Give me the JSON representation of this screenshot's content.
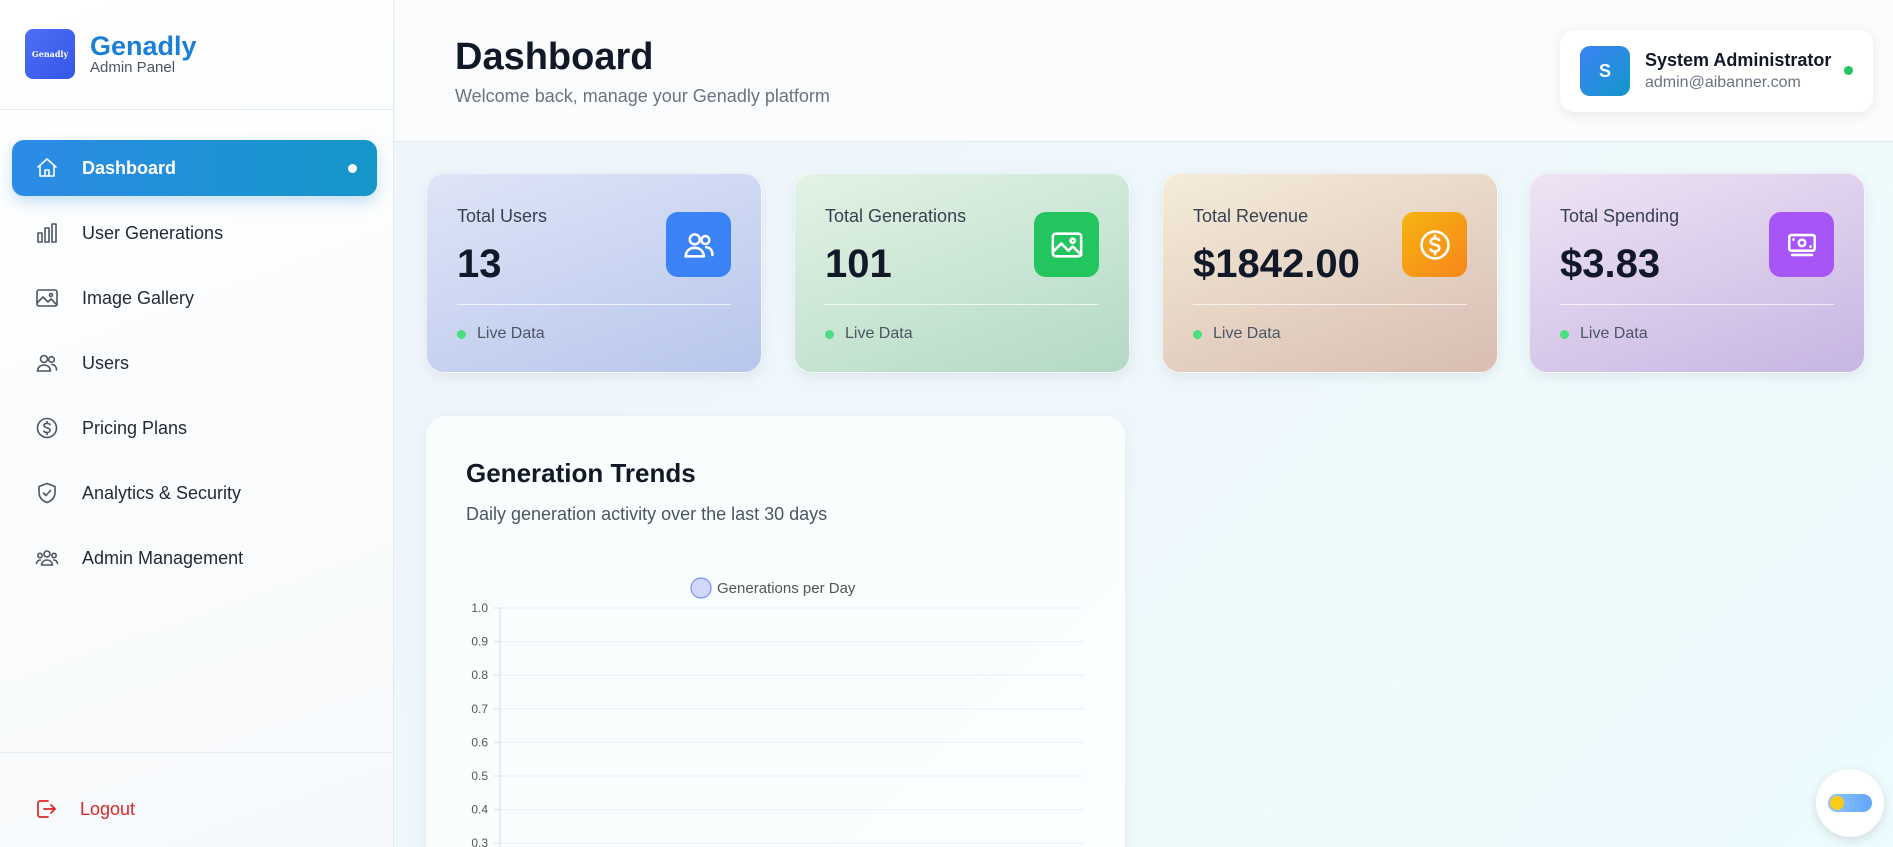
{
  "brand": {
    "logo_text": "Genadly",
    "name": "Genadly",
    "subtitle": "Admin Panel"
  },
  "sidebar": {
    "items": [
      {
        "label": "Dashboard",
        "icon": "home-icon",
        "active": true
      },
      {
        "label": "User Generations",
        "icon": "bar-chart-icon"
      },
      {
        "label": "Image Gallery",
        "icon": "image-icon"
      },
      {
        "label": "Users",
        "icon": "users-icon"
      },
      {
        "label": "Pricing Plans",
        "icon": "dollar-circle-icon"
      },
      {
        "label": "Analytics & Security",
        "icon": "shield-check-icon"
      },
      {
        "label": "Admin Management",
        "icon": "team-icon"
      }
    ],
    "logout_label": "Logout"
  },
  "header": {
    "title": "Dashboard",
    "subtitle": "Welcome back, manage your Genadly platform",
    "user": {
      "initial": "S",
      "name": "System Administrator",
      "email": "admin@aibanner.com",
      "status": "online"
    }
  },
  "stats": [
    {
      "label": "Total Users",
      "value": "13",
      "status": "Live Data",
      "icon": "users-icon",
      "color": "#3b82f6"
    },
    {
      "label": "Total Generations",
      "value": "101",
      "status": "Live Data",
      "icon": "image-icon",
      "color": "#22c55e"
    },
    {
      "label": "Total Revenue",
      "value": "$1842.00",
      "status": "Live Data",
      "icon": "dollar-circle-icon",
      "color": "#f59e0b"
    },
    {
      "label": "Total Spending",
      "value": "$3.83",
      "status": "Live Data",
      "icon": "money-icon",
      "color": "#a855f7"
    }
  ],
  "chart": {
    "title": "Generation Trends",
    "subtitle": "Daily generation activity over the last 30 days"
  },
  "chart_data": {
    "type": "line",
    "series": [
      {
        "name": "Generations per Day",
        "values": []
      }
    ],
    "y_ticks": [
      "1.0",
      "0.9",
      "0.8",
      "0.7",
      "0.6",
      "0.5",
      "0.4",
      "0.3"
    ],
    "ylim": [
      0,
      1.0
    ],
    "grid": true,
    "legend": "top-center"
  },
  "theme_toggle": {
    "icon": "sun-toggle-icon"
  }
}
